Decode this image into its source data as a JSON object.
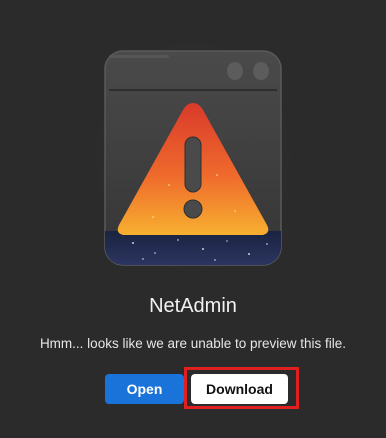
{
  "file_preview": {
    "file_name": "NetAdmin",
    "message": "Hmm... looks like we are unable to preview this file.",
    "illustration_icon": "warning-icon",
    "colors": {
      "background": "#2b2b2b",
      "open_button": "#1a73d9",
      "download_button": "#ffffff",
      "highlight": "#e0201f",
      "warning_top": "#e64a2e",
      "warning_bottom": "#f5a42a"
    }
  },
  "actions": {
    "open_label": "Open",
    "download_label": "Download"
  }
}
